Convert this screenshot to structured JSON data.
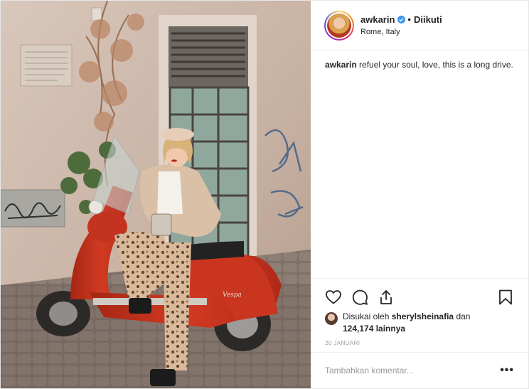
{
  "post": {
    "username": "awkarin",
    "follow_label": "Diikuti",
    "location": "Rome, Italy",
    "caption_user": "awkarin",
    "caption_text": "refuel your soul, love, this is a long drive.",
    "likes_prefix": "Disukai oleh",
    "liked_by": "sherylsheinafia",
    "likes_conj": "dan",
    "likes_count": "124,174 lainnya",
    "date": "20 JANUARI",
    "comment_placeholder": "Tambahkan komentar...",
    "more_label": "•••"
  },
  "photo": {
    "graffiti_text": "Vespa"
  },
  "icons": {
    "verified": "verified-badge-icon",
    "like": "heart-icon",
    "comment": "comment-icon",
    "share": "share-icon",
    "save": "bookmark-icon",
    "more": "more-options-icon"
  },
  "colors": {
    "verified_blue": "#3897f0",
    "scooter_red": "#c7321e",
    "wall": "#cbb6a8"
  }
}
